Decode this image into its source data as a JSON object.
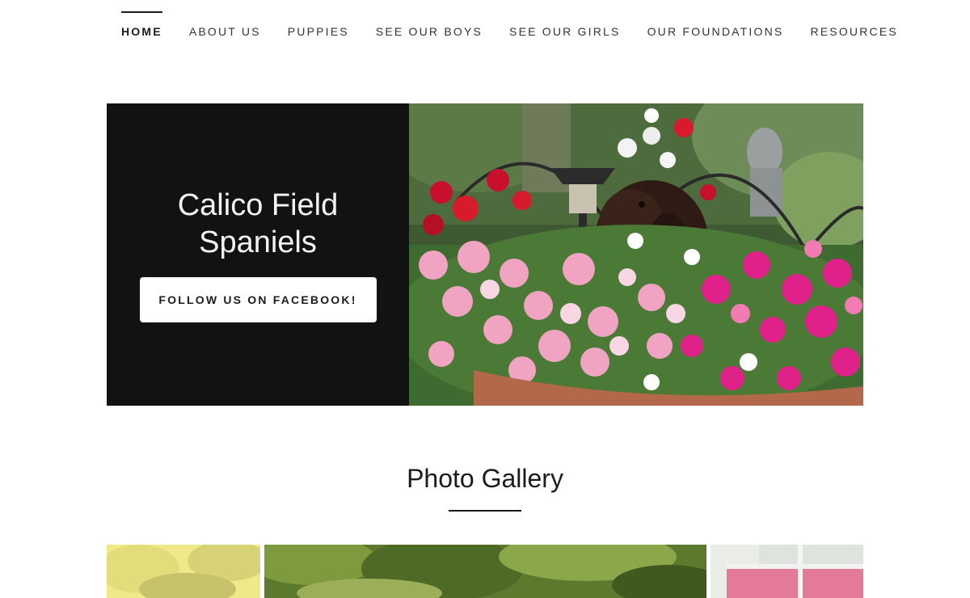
{
  "nav": {
    "items": [
      {
        "label": "HOME",
        "active": true
      },
      {
        "label": "ABOUT US",
        "active": false
      },
      {
        "label": "PUPPIES",
        "active": false
      },
      {
        "label": "SEE OUR BOYS",
        "active": false
      },
      {
        "label": "SEE OUR GIRLS",
        "active": false
      },
      {
        "label": "OUR FOUNDATIONS",
        "active": false
      },
      {
        "label": "RESOURCES",
        "active": false
      }
    ]
  },
  "hero": {
    "title": "Calico Field Spaniels",
    "button_label": "FOLLOW US ON FACEBOOK!",
    "panel_color": "#121212",
    "image": "puppy-in-flower-pot-photo"
  },
  "gallery": {
    "heading": "Photo Gallery",
    "thumbnails": [
      {
        "image": "yellow-foliage-photo"
      },
      {
        "image": "green-trees-photo"
      },
      {
        "image": "pink-banner-photo"
      }
    ]
  }
}
